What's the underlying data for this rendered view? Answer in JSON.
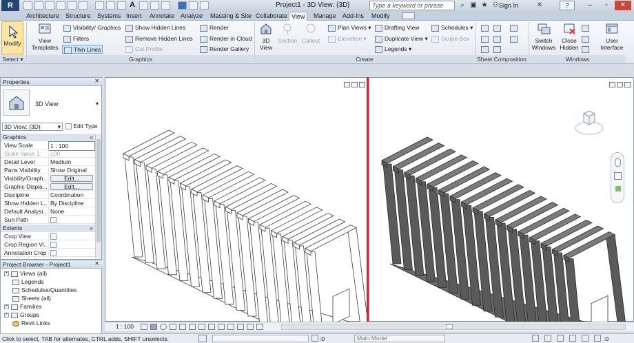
{
  "app": {
    "logo": "R",
    "document_title": "Project1 - 3D View: {3D}"
  },
  "search": {
    "placeholder": "Type a keyword or phrase"
  },
  "titlebar": {
    "sign_in": "Sign In",
    "help": "?"
  },
  "tabs": [
    "Architecture",
    "Structure",
    "Systems",
    "Insert",
    "Annotate",
    "Analyze",
    "Massing & Site",
    "Collaborate",
    "View",
    "Manage",
    "Add-Ins",
    "Modify"
  ],
  "active_tab": "View",
  "ribbon": {
    "select": {
      "modify": "Modify",
      "title": "Select"
    },
    "graphics": {
      "title": "Graphics",
      "view_templates": "View Templates",
      "visibility_graphics": "Visibility/ Graphics",
      "filters": "Filters",
      "thin_lines": "Thin Lines",
      "show_hidden_lines": "Show Hidden Lines",
      "remove_hidden_lines": "Remove Hidden Lines",
      "cut_profile": "Cut Profile",
      "render": "Render",
      "render_in_cloud": "Render in Cloud",
      "render_gallery": "Render Gallery"
    },
    "create": {
      "title": "Create",
      "view_3d": "3D View",
      "section": "Section",
      "callout": "Callout",
      "plan_views": "Plan Views",
      "elevation": "Elevation",
      "drafting_view": "Drafting View",
      "duplicate_view": "Duplicate View",
      "legends": "Legends",
      "schedules": "Schedules",
      "scope_box": "Scope Box"
    },
    "sheet_composition": {
      "title": "Sheet Composition"
    },
    "windows": {
      "title": "Windows",
      "switch_windows": "Switch Windows",
      "close_hidden": "Close Hidden",
      "user_interface": "User Interface"
    }
  },
  "properties": {
    "title": "Properties",
    "type_name": "3D View",
    "selector": "3D View: {3D}",
    "edit_type": "Edit Type",
    "groups": [
      {
        "name": "Graphics",
        "rows": [
          {
            "key": "View Scale",
            "value": "1 : 100",
            "kind": "input"
          },
          {
            "key": "Scale Value    1:",
            "value": "100",
            "kind": "disabled"
          },
          {
            "key": "Detail Level",
            "value": "Medium",
            "kind": "text"
          },
          {
            "key": "Parts Visibility",
            "value": "Show Original",
            "kind": "text"
          },
          {
            "key": "Visibility/Graph...",
            "value": "Edit...",
            "kind": "button"
          },
          {
            "key": "Graphic Displa...",
            "value": "Edit...",
            "kind": "button"
          },
          {
            "key": "Discipline",
            "value": "Coordination",
            "kind": "text"
          },
          {
            "key": "Show Hidden L...",
            "value": "By Discipline",
            "kind": "text"
          },
          {
            "key": "Default Analysi...",
            "value": "None",
            "kind": "text"
          },
          {
            "key": "Sun Path",
            "value": "",
            "kind": "checkbox"
          }
        ]
      },
      {
        "name": "Extents",
        "rows": [
          {
            "key": "Crop View",
            "value": "",
            "kind": "checkbox"
          },
          {
            "key": "Crop Region Vi...",
            "value": "",
            "kind": "checkbox"
          },
          {
            "key": "Annotation Crop",
            "value": "",
            "kind": "checkbox"
          }
        ]
      }
    ]
  },
  "project_browser": {
    "title": "Project Browser - Project1",
    "nodes": [
      "Views (all)",
      "Legends",
      "Schedules/Quantities",
      "Sheets (all)",
      "Families",
      "Groups",
      "Revit Links"
    ]
  },
  "viewbar": {
    "scale": "1 : 100"
  },
  "status": {
    "message": "Click to select, TAB for alternates, CTRL adds, SHIFT unselects.",
    "workset": ":0",
    "model": "Main Model",
    "filter_count": ":0"
  },
  "colors": {
    "active_view_border": "#e02424",
    "ribbon_accent": "#fbe6a7",
    "model_shaded": "#5a5a5a"
  }
}
